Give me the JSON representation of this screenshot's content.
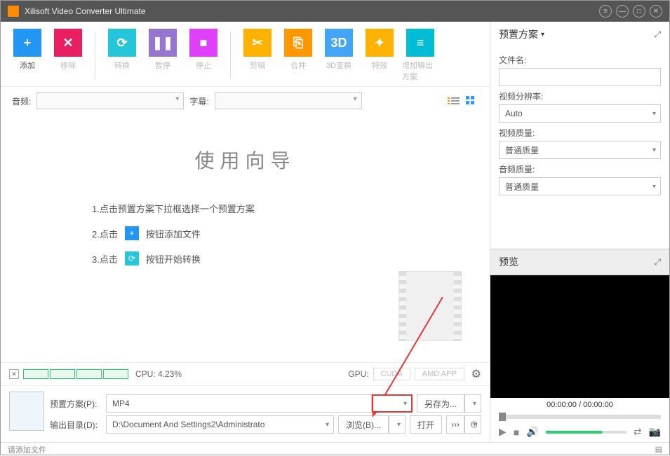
{
  "title": "Xilisoft Video Converter Ultimate",
  "toolbar": [
    {
      "icon": "+",
      "label": "添加",
      "color": "blue"
    },
    {
      "icon": "✕",
      "label": "移除",
      "color": "pink"
    },
    {
      "icon": "⟳",
      "label": "转换",
      "color": "teal"
    },
    {
      "icon": "❚❚",
      "label": "暂停",
      "color": "purple"
    },
    {
      "icon": "■",
      "label": "停止",
      "color": "mag"
    },
    {
      "icon": "✂",
      "label": "剪辑",
      "color": "orange"
    },
    {
      "icon": "⎘",
      "label": "合并",
      "color": "dorange"
    },
    {
      "icon": "3D",
      "label": "3D变换",
      "color": "lblue"
    },
    {
      "icon": "✦",
      "label": "特效",
      "color": "orange"
    },
    {
      "icon": "≡",
      "label": "增加输出方案",
      "color": "cyan"
    }
  ],
  "filters": {
    "audio_label": "音频:",
    "subtitle_label": "字幕:"
  },
  "wizard": {
    "title": "使用向导",
    "step1": "1.点击预置方案下拉框选择一个预置方案",
    "step2_a": "2.点击",
    "step2_b": "按钮添加文件",
    "step3_a": "3.点击",
    "step3_b": "按钮开始转换"
  },
  "sys": {
    "cpu_label": "CPU: 4.23%",
    "gpu_label": "GPU:",
    "cuda": "CUDA",
    "amd": "AMD APP"
  },
  "bottom": {
    "profile_label": "预置方案(P):",
    "profile_value": "MP4",
    "saveas": "另存为...",
    "outdir_label": "输出目录(D):",
    "outdir_value": "D:\\Document And Settings2\\Administrato",
    "browse": "浏览(B)...",
    "open": "打开",
    "more": "›››"
  },
  "status": "请添加文件",
  "preset": {
    "header": "预置方案",
    "filename_label": "文件名:",
    "res_label": "视频分辨率:",
    "res_value": "Auto",
    "vq_label": "视频质量:",
    "vq_value": "普通质量",
    "aq_label": "音频质量:",
    "aq_value": "普通质量"
  },
  "preview": {
    "header": "预览",
    "time": "00:00:00 / 00:00:00"
  }
}
